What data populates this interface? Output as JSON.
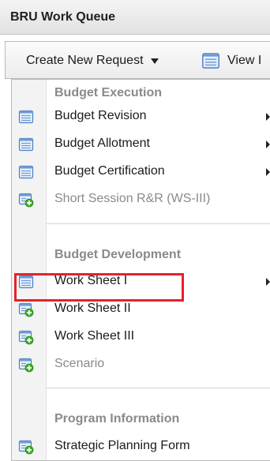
{
  "panel": {
    "title": "BRU Work Queue"
  },
  "toolbar": {
    "create_label": "Create New Request",
    "view_label": "View I"
  },
  "menu": {
    "budget_execution": {
      "header": "Budget Execution",
      "items": [
        {
          "label": "Budget Revision",
          "icon": "list-document-icon",
          "submenu": true,
          "enabled": true
        },
        {
          "label": "Budget Allotment",
          "icon": "list-document-icon",
          "submenu": true,
          "enabled": true
        },
        {
          "label": "Budget Certification",
          "icon": "list-document-icon",
          "submenu": true,
          "enabled": true
        },
        {
          "label": "Short Session R&R (WS-III)",
          "icon": "new-document-icon",
          "submenu": false,
          "enabled": false
        }
      ]
    },
    "budget_development": {
      "header": "Budget Development",
      "items": [
        {
          "label": "Work Sheet I",
          "icon": "list-document-icon",
          "submenu": true,
          "enabled": true
        },
        {
          "label": "Work Sheet II",
          "icon": "new-document-icon",
          "submenu": false,
          "enabled": true,
          "highlighted": true
        },
        {
          "label": "Work Sheet III",
          "icon": "new-document-icon",
          "submenu": false,
          "enabled": true
        },
        {
          "label": "Scenario",
          "icon": "new-document-icon",
          "submenu": false,
          "enabled": false
        }
      ]
    },
    "program_information": {
      "header": "Program Information",
      "items": [
        {
          "label": "Strategic Planning Form",
          "icon": "new-document-icon",
          "submenu": false,
          "enabled": true
        }
      ]
    }
  },
  "colors": {
    "highlight_border": "#e3232b",
    "icon_blue": "#4a7fc1",
    "icon_green": "#3fae2a",
    "disabled_text": "#8a8a8a"
  }
}
